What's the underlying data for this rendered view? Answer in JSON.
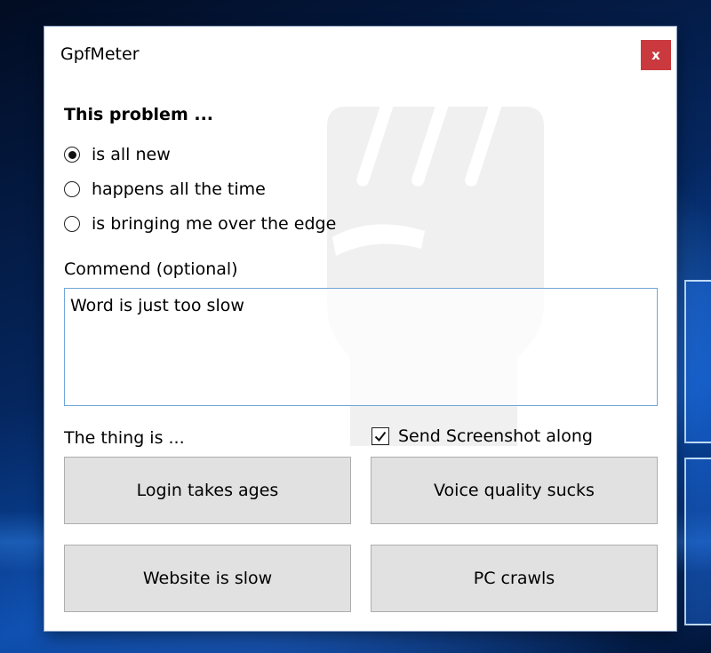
{
  "window": {
    "title": "GpfMeter",
    "close_label": "x",
    "close_color": "#c9393d"
  },
  "problem": {
    "heading": "This problem ...",
    "options": [
      {
        "label": "is all new",
        "selected": true
      },
      {
        "label": "happens all the time",
        "selected": false
      },
      {
        "label": "is bringing me over the edge",
        "selected": false
      }
    ]
  },
  "comment": {
    "label": "Commend (optional)",
    "value": "Word is just too slow"
  },
  "thing": {
    "label": "The thing is ...",
    "screenshot_label": "Send Screenshot along",
    "screenshot_checked": true
  },
  "buttons": [
    {
      "label": "Login takes ages"
    },
    {
      "label": "Voice quality sucks"
    },
    {
      "label": "Website is slow"
    },
    {
      "label": "PC crawls"
    }
  ],
  "icons": {
    "watermark": "fist-icon"
  }
}
